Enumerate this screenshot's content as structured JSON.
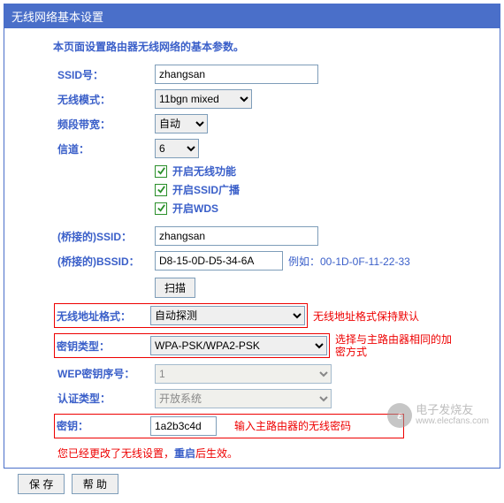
{
  "title": "无线网络基本设置",
  "intro": "本页面设置路由器无线网络的基本参数。",
  "rows": {
    "ssid_label": "SSID号：",
    "ssid_value": "zhangsan",
    "mode_label": "无线模式：",
    "mode_value": "11bgn mixed",
    "bandwidth_label": "频段带宽：",
    "bandwidth_value": "自动",
    "channel_label": "信道：",
    "channel_value": "6",
    "cb_enable": "开启无线功能",
    "cb_ssid": "开启SSID广播",
    "cb_wds": "开启WDS",
    "bridge_ssid_label": "(桥接的)SSID：",
    "bridge_ssid_value": "zhangsan",
    "bridge_bssid_label": "(桥接的)BSSID：",
    "bridge_bssid_value": "D8-15-0D-D5-34-6A",
    "bssid_example": "例如：00-1D-0F-11-22-33",
    "scan_btn": "扫描",
    "addr_fmt_label": "无线地址格式：",
    "addr_fmt_value": "自动探测",
    "addr_fmt_note": "无线地址格式保持默认",
    "key_type_label": "密钥类型：",
    "key_type_value": "WPA-PSK/WPA2-PSK",
    "key_type_note": "选择与主路由器相同的加密方式",
    "wep_idx_label": "WEP密钥序号：",
    "wep_idx_value": "1",
    "auth_label": "认证类型：",
    "auth_value": "开放系统",
    "key_label": "密钥：",
    "key_value": "1a2b3c4d",
    "key_note": "输入主路由器的无线密码"
  },
  "changed_note_prefix": "您已经更改了无线设置，",
  "changed_note_link": "重启",
  "changed_note_suffix": "后生效。",
  "buttons": {
    "save": "保 存",
    "help": "帮 助"
  },
  "watermark": {
    "cn": "电子发烧友",
    "url": "www.elecfans.com"
  }
}
